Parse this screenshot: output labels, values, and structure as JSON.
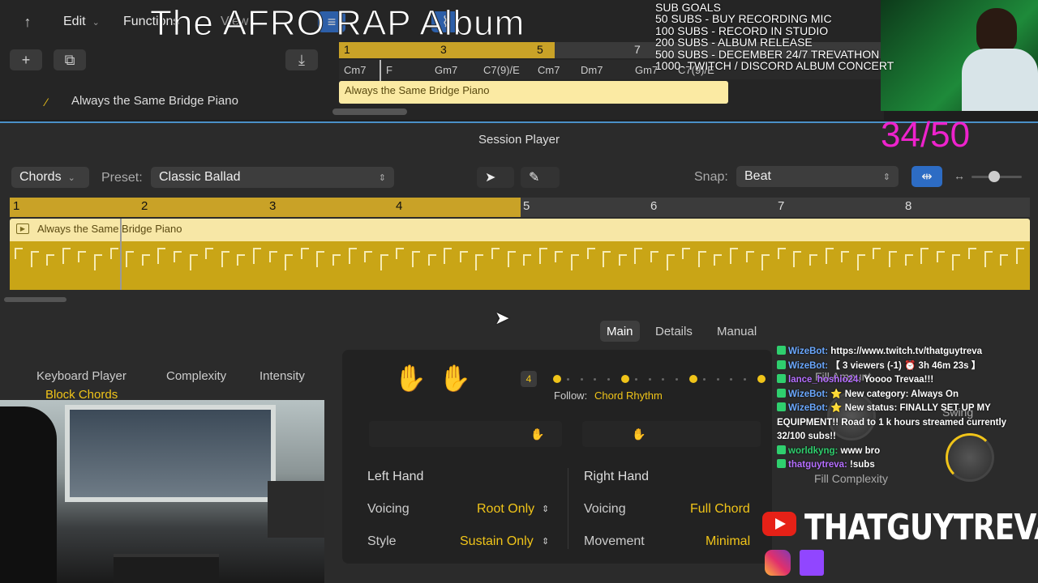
{
  "toolbar": {
    "edit": "Edit",
    "functions": "Functions",
    "view": "View",
    "plus": "+"
  },
  "top_ruler": {
    "bars": [
      "1",
      "3",
      "5",
      "7"
    ],
    "chords": [
      "Cm7",
      "F",
      "Gm7",
      "C7(9)/E",
      "Cm7",
      "Dm7",
      "Gm7",
      "C7(9)/E"
    ]
  },
  "top_region": {
    "name": "Always the Same Bridge Piano"
  },
  "track": {
    "name": "Always the Same Bridge Piano"
  },
  "overlay": {
    "title": "The AFRO RAP Album",
    "goals": [
      "SUB GOALS",
      "50 SUBS - BUY RECORDING MIC",
      "100 SUBS - RECORD IN STUDIO",
      "200 SUBS - ALBUM RELEASE",
      "500 SUBS - DECEMBER 24/7 TREVATHON",
      "1000- TWITCH / DISCORD ALBUM CONCERT"
    ],
    "counter": "34/50",
    "brand": "THATGUYTREVA"
  },
  "session_player": {
    "title": "Session Player",
    "mode": "Chords",
    "preset_label": "Preset:",
    "preset": "Classic Ballad",
    "snap_label": "Snap:",
    "snap": "Beat",
    "bars": [
      "1",
      "2",
      "3",
      "4",
      "5",
      "6",
      "7",
      "8"
    ],
    "region_name": "Always the Same Bridge Piano",
    "tabs": [
      "Main",
      "Details",
      "Manual"
    ],
    "active_tab": "Main",
    "left_tabs": [
      "Keyboard Player",
      "Complexity",
      "Intensity"
    ],
    "player": "Block Chords",
    "beat_number": "4",
    "follow_label": "Follow:",
    "follow_value": "Chord Rhythm",
    "left_hand": {
      "title": "Left Hand",
      "voicing_label": "Voicing",
      "voicing": "Root Only",
      "style_label": "Style",
      "style": "Sustain Only"
    },
    "right_hand": {
      "title": "Right Hand",
      "voicing_label": "Voicing",
      "voicing": "Full Chord",
      "movement_label": "Movement",
      "movement": "Minimal"
    },
    "knobs": [
      "Fill Amount",
      "Swing",
      "Fill Complexity"
    ]
  },
  "chat": [
    {
      "user": "WizeBot:",
      "msg": " https://www.twitch.tv/thatguytreva",
      "color": "#6aa8ff"
    },
    {
      "user": "WizeBot:",
      "msg": " 【 3 viewers (-1) ⏰ 3h 46m 23s 】",
      "color": "#6aa8ff"
    },
    {
      "user": "lance_hoshio24:",
      "msg": " Yoooo Trevaa!!!",
      "color": "#b56eff"
    },
    {
      "user": "WizeBot:",
      "msg": " ⭐ New category: Always On",
      "color": "#6aa8ff"
    },
    {
      "user": "WizeBot:",
      "msg": " ⭐ New status: FINALLY SET UP MY",
      "color": "#6aa8ff"
    },
    {
      "user": "",
      "msg": "EQUIPMENT!! Road to 1 k hours streamed currently",
      "color": "#ffffff"
    },
    {
      "user": "",
      "msg": "32/100 subs!!",
      "color": "#ffffff"
    },
    {
      "user": "worldkyng:",
      "msg": " www bro",
      "color": "#2fcf6e"
    },
    {
      "user": "thatguytreva:",
      "msg": " !subs",
      "color": "#b56eff"
    }
  ]
}
